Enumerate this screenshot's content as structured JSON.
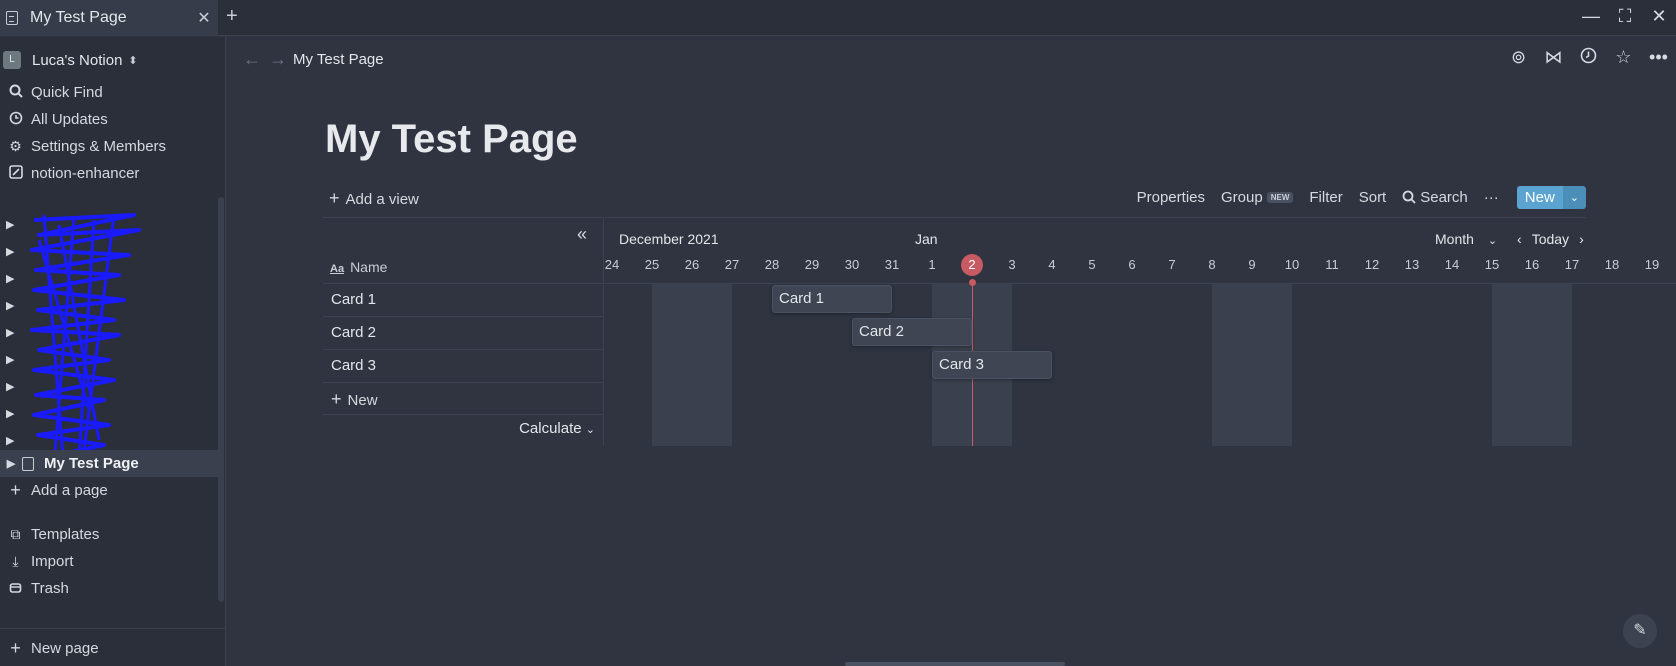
{
  "tab": {
    "title": "My Test Page",
    "close": "✕",
    "add": "+"
  },
  "window_controls": {
    "minimize": "—",
    "maximize": "⛶",
    "close": "✕"
  },
  "sidebar": {
    "workspace": {
      "avatar": "L",
      "name": "Luca's Notion"
    },
    "items": [
      {
        "label": "Quick Find",
        "icon": "search-icon"
      },
      {
        "label": "All Updates",
        "icon": "clock-icon"
      },
      {
        "label": "Settings & Members",
        "icon": "gear-icon"
      },
      {
        "label": "notion-enhancer",
        "icon": "enhancer-icon"
      }
    ],
    "active_page": "My Test Page",
    "add_page": "Add a page",
    "bottom_items": [
      {
        "label": "Templates",
        "icon": "templates-icon"
      },
      {
        "label": "Import",
        "icon": "import-icon"
      },
      {
        "label": "Trash",
        "icon": "trash-icon"
      }
    ],
    "new_page": "New page"
  },
  "topbar": {
    "breadcrumb": "My Test Page"
  },
  "page": {
    "title": "My Test Page"
  },
  "view_bar": {
    "add_view": "Add a view",
    "properties": "Properties",
    "group": "Group",
    "group_badge": "NEW",
    "filter": "Filter",
    "sort": "Sort",
    "search": "Search",
    "more": "···",
    "new": "New"
  },
  "table": {
    "name_header": "Name",
    "name_icon": "Aa",
    "rows": [
      "Card 1",
      "Card 2",
      "Card 3"
    ],
    "new_row": "New",
    "calculate": "Calculate"
  },
  "timeline": {
    "months": [
      "December 2021",
      "Jan"
    ],
    "scale": "Month",
    "today_label": "Today",
    "days": [
      "24",
      "25",
      "26",
      "27",
      "28",
      "29",
      "30",
      "31",
      "1",
      "2",
      "3",
      "4",
      "5",
      "6",
      "7",
      "8",
      "9",
      "10",
      "11",
      "12",
      "13",
      "14",
      "15",
      "16",
      "17",
      "18",
      "19"
    ],
    "today_day": "2",
    "cards": [
      {
        "label": "Card 1",
        "start": "2021-12-28",
        "end": "2021-12-31"
      },
      {
        "label": "Card 2",
        "start": "2021-12-30",
        "end": "2022-01-02"
      },
      {
        "label": "Card 3",
        "start": "2022-01-01",
        "end": "2022-01-04"
      }
    ],
    "accent": "#c75a63"
  },
  "colors": {
    "background": "#2f3440",
    "sidebar": "#2a2f3a",
    "new_button": "#5ba3d0"
  }
}
